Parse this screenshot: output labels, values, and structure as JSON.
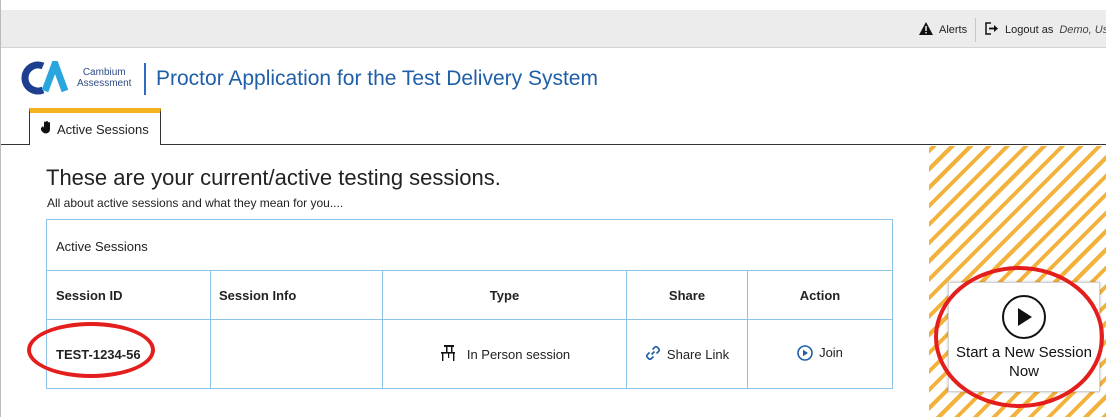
{
  "topbar": {
    "alerts_label": "Alerts",
    "logout_label": "Logout as",
    "logout_user": "Demo, Use"
  },
  "header": {
    "logo_line1": "Cambium",
    "logo_line2": "Assessment",
    "app_title": "Proctor Application for the Test Delivery System"
  },
  "tabs": [
    {
      "label": "Active Sessions",
      "icon": "hand-icon",
      "active": true
    }
  ],
  "main": {
    "heading": "These are your current/active testing sessions.",
    "subheading": "All about active sessions and what they mean for you...."
  },
  "table": {
    "caption": "Active Sessions",
    "columns": [
      "Session ID",
      "Session Info",
      "Type",
      "Share",
      "Action"
    ],
    "rows": [
      {
        "session_id": "TEST-1234-56",
        "session_info": "",
        "type": "In Person session",
        "share": "Share Link",
        "action": "Join"
      }
    ]
  },
  "new_session": {
    "label": "Start a New Session Now"
  },
  "colors": {
    "accent_blue": "#1f5fa8",
    "tab_accent": "#f2b31f",
    "stripe": "#f3b23c",
    "annotation_red": "#e41d1d",
    "table_border": "#8cc4e9"
  }
}
